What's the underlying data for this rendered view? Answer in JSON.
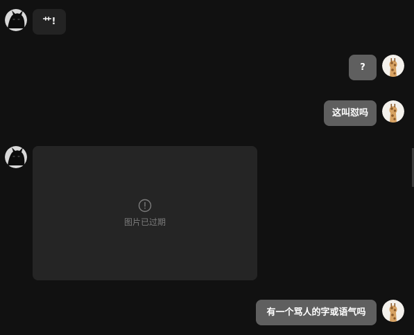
{
  "messages": [
    {
      "side": "left",
      "type": "text",
      "text": "艹!"
    },
    {
      "side": "right",
      "type": "text",
      "text": "?"
    },
    {
      "side": "right",
      "type": "text",
      "text": "这叫怼吗"
    },
    {
      "side": "left",
      "type": "image",
      "status_text": "图片已过期",
      "status_icon": "alert-circle-icon"
    },
    {
      "side": "right",
      "type": "text",
      "text": "有一个骂人的字或语气吗"
    }
  ],
  "avatars": {
    "left": "black-cat-avatar",
    "right": "giraffe-avatar"
  },
  "colors": {
    "background": "#111111",
    "incoming_bubble": "#232323",
    "outgoing_bubble": "#5f5f5f",
    "expired_card": "#252525",
    "muted_text": "#7c7c7c"
  }
}
